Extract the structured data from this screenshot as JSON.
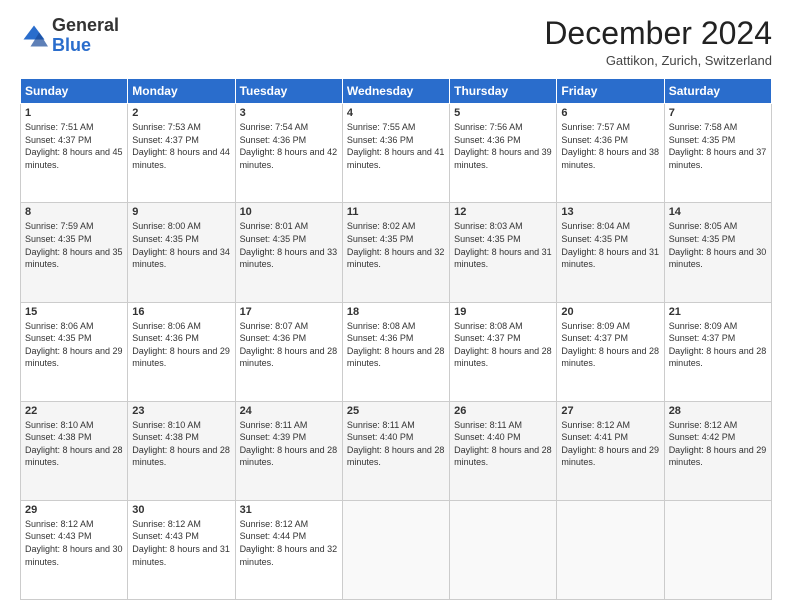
{
  "header": {
    "logo_general": "General",
    "logo_blue": "Blue",
    "month_title": "December 2024",
    "location": "Gattikon, Zurich, Switzerland"
  },
  "weekdays": [
    "Sunday",
    "Monday",
    "Tuesday",
    "Wednesday",
    "Thursday",
    "Friday",
    "Saturday"
  ],
  "weeks": [
    [
      {
        "day": "1",
        "sunrise": "7:51 AM",
        "sunset": "4:37 PM",
        "daylight": "8 hours and 45 minutes."
      },
      {
        "day": "2",
        "sunrise": "7:53 AM",
        "sunset": "4:37 PM",
        "daylight": "8 hours and 44 minutes."
      },
      {
        "day": "3",
        "sunrise": "7:54 AM",
        "sunset": "4:36 PM",
        "daylight": "8 hours and 42 minutes."
      },
      {
        "day": "4",
        "sunrise": "7:55 AM",
        "sunset": "4:36 PM",
        "daylight": "8 hours and 41 minutes."
      },
      {
        "day": "5",
        "sunrise": "7:56 AM",
        "sunset": "4:36 PM",
        "daylight": "8 hours and 39 minutes."
      },
      {
        "day": "6",
        "sunrise": "7:57 AM",
        "sunset": "4:36 PM",
        "daylight": "8 hours and 38 minutes."
      },
      {
        "day": "7",
        "sunrise": "7:58 AM",
        "sunset": "4:35 PM",
        "daylight": "8 hours and 37 minutes."
      }
    ],
    [
      {
        "day": "8",
        "sunrise": "7:59 AM",
        "sunset": "4:35 PM",
        "daylight": "8 hours and 35 minutes."
      },
      {
        "day": "9",
        "sunrise": "8:00 AM",
        "sunset": "4:35 PM",
        "daylight": "8 hours and 34 minutes."
      },
      {
        "day": "10",
        "sunrise": "8:01 AM",
        "sunset": "4:35 PM",
        "daylight": "8 hours and 33 minutes."
      },
      {
        "day": "11",
        "sunrise": "8:02 AM",
        "sunset": "4:35 PM",
        "daylight": "8 hours and 32 minutes."
      },
      {
        "day": "12",
        "sunrise": "8:03 AM",
        "sunset": "4:35 PM",
        "daylight": "8 hours and 31 minutes."
      },
      {
        "day": "13",
        "sunrise": "8:04 AM",
        "sunset": "4:35 PM",
        "daylight": "8 hours and 31 minutes."
      },
      {
        "day": "14",
        "sunrise": "8:05 AM",
        "sunset": "4:35 PM",
        "daylight": "8 hours and 30 minutes."
      }
    ],
    [
      {
        "day": "15",
        "sunrise": "8:06 AM",
        "sunset": "4:35 PM",
        "daylight": "8 hours and 29 minutes."
      },
      {
        "day": "16",
        "sunrise": "8:06 AM",
        "sunset": "4:36 PM",
        "daylight": "8 hours and 29 minutes."
      },
      {
        "day": "17",
        "sunrise": "8:07 AM",
        "sunset": "4:36 PM",
        "daylight": "8 hours and 28 minutes."
      },
      {
        "day": "18",
        "sunrise": "8:08 AM",
        "sunset": "4:36 PM",
        "daylight": "8 hours and 28 minutes."
      },
      {
        "day": "19",
        "sunrise": "8:08 AM",
        "sunset": "4:37 PM",
        "daylight": "8 hours and 28 minutes."
      },
      {
        "day": "20",
        "sunrise": "8:09 AM",
        "sunset": "4:37 PM",
        "daylight": "8 hours and 28 minutes."
      },
      {
        "day": "21",
        "sunrise": "8:09 AM",
        "sunset": "4:37 PM",
        "daylight": "8 hours and 28 minutes."
      }
    ],
    [
      {
        "day": "22",
        "sunrise": "8:10 AM",
        "sunset": "4:38 PM",
        "daylight": "8 hours and 28 minutes."
      },
      {
        "day": "23",
        "sunrise": "8:10 AM",
        "sunset": "4:38 PM",
        "daylight": "8 hours and 28 minutes."
      },
      {
        "day": "24",
        "sunrise": "8:11 AM",
        "sunset": "4:39 PM",
        "daylight": "8 hours and 28 minutes."
      },
      {
        "day": "25",
        "sunrise": "8:11 AM",
        "sunset": "4:40 PM",
        "daylight": "8 hours and 28 minutes."
      },
      {
        "day": "26",
        "sunrise": "8:11 AM",
        "sunset": "4:40 PM",
        "daylight": "8 hours and 28 minutes."
      },
      {
        "day": "27",
        "sunrise": "8:12 AM",
        "sunset": "4:41 PM",
        "daylight": "8 hours and 29 minutes."
      },
      {
        "day": "28",
        "sunrise": "8:12 AM",
        "sunset": "4:42 PM",
        "daylight": "8 hours and 29 minutes."
      }
    ],
    [
      {
        "day": "29",
        "sunrise": "8:12 AM",
        "sunset": "4:43 PM",
        "daylight": "8 hours and 30 minutes."
      },
      {
        "day": "30",
        "sunrise": "8:12 AM",
        "sunset": "4:43 PM",
        "daylight": "8 hours and 31 minutes."
      },
      {
        "day": "31",
        "sunrise": "8:12 AM",
        "sunset": "4:44 PM",
        "daylight": "8 hours and 32 minutes."
      },
      null,
      null,
      null,
      null
    ]
  ]
}
